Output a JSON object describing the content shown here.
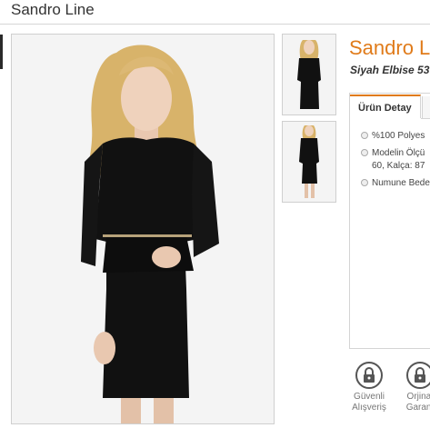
{
  "page": {
    "title": "Sandro Line"
  },
  "product": {
    "name": "Sandro L",
    "subtitle": "Siyah Elbise 53"
  },
  "details": {
    "tab_label": "Ürün Detay",
    "items": [
      {
        "lines": [
          "%100 Polyes"
        ]
      },
      {
        "lines": [
          "Modelin Ölçü",
          "60, Kalça: 87"
        ]
      },
      {
        "lines": [
          "Numune Bede"
        ]
      }
    ]
  },
  "badges": [
    {
      "line1": "Güvenli",
      "line2": "Alışveriş",
      "icon": "lock-icon"
    },
    {
      "line1": "Orjinal",
      "line2": "Garant",
      "icon": "lock-icon"
    }
  ],
  "colors": {
    "accent": "#e07b1a",
    "dress": "#111111",
    "hair": "#d8b36a"
  }
}
